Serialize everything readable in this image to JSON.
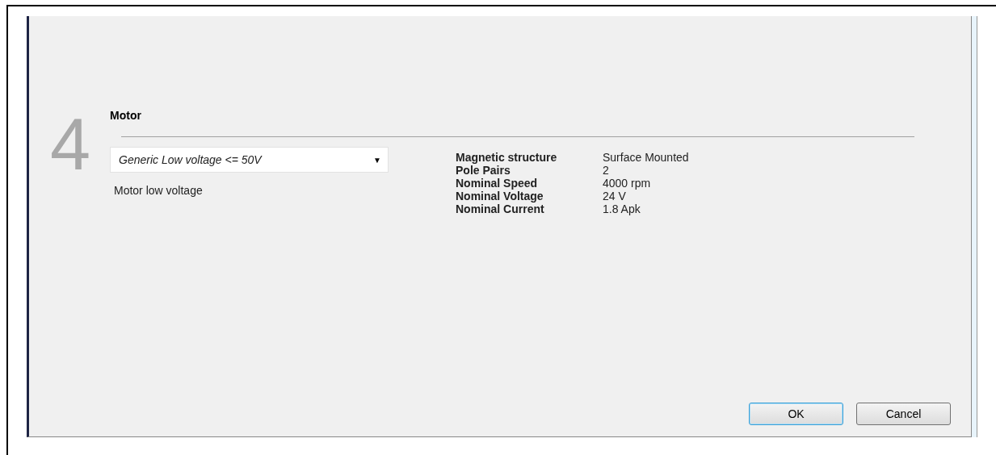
{
  "step": {
    "number": "4",
    "title": "Motor"
  },
  "motor_select": {
    "value": "Generic Low voltage <= 50V",
    "arrow": "▼"
  },
  "description": "Motor low voltage",
  "properties": [
    {
      "label": "Magnetic structure",
      "value": "Surface Mounted"
    },
    {
      "label": "Pole Pairs",
      "value": "2"
    },
    {
      "label": "Nominal Speed",
      "value": "4000 rpm"
    },
    {
      "label": "Nominal Voltage",
      "value": "24 V"
    },
    {
      "label": "Nominal Current",
      "value": "1.8 Apk"
    }
  ],
  "buttons": [
    {
      "label": "OK",
      "default": true
    },
    {
      "label": "Cancel",
      "default": false
    }
  ]
}
